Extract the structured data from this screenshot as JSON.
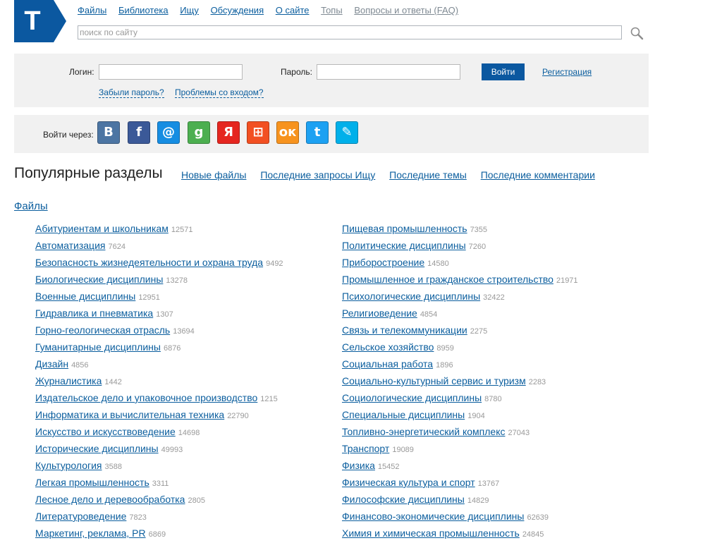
{
  "logo": {
    "letter": "T"
  },
  "topnav": [
    {
      "label": "Файлы"
    },
    {
      "label": "Библиотека"
    },
    {
      "label": "Ищу"
    },
    {
      "label": "Обсуждения"
    },
    {
      "label": "О сайте"
    },
    {
      "label": "Топы"
    },
    {
      "label": "Вопросы и ответы (FAQ)"
    }
  ],
  "search": {
    "placeholder": "поиск по сайту",
    "value": ""
  },
  "login": {
    "login_label": "Логин:",
    "password_label": "Пароль:",
    "submit_label": "Войти",
    "register_label": "Регистрация",
    "forgot_label": "Забыли пароль?",
    "problems_label": "Проблемы со входом?"
  },
  "social": {
    "label": "Войти через:",
    "providers": [
      {
        "name": "vkontakte-icon",
        "glyph": "В",
        "color": "#4c75a3"
      },
      {
        "name": "facebook-icon",
        "glyph": "f",
        "color": "#3b5998"
      },
      {
        "name": "mailru-icon",
        "glyph": "@",
        "color": "#168de2"
      },
      {
        "name": "google-icon",
        "glyph": "g",
        "color": "#4caf50"
      },
      {
        "name": "yandex-icon",
        "glyph": "Я",
        "color": "#e52620"
      },
      {
        "name": "windows-live-icon",
        "glyph": "⊞",
        "color": "#f25022"
      },
      {
        "name": "odnoklassniki-icon",
        "glyph": "ок",
        "color": "#f7931e"
      },
      {
        "name": "twitter-icon",
        "glyph": "t",
        "color": "#1da1f2"
      },
      {
        "name": "livejournal-icon",
        "glyph": "✎",
        "color": "#00b0ea"
      }
    ]
  },
  "section": {
    "title": "Популярные разделы",
    "tabs": [
      {
        "label": "Новые файлы"
      },
      {
        "label": "Последние запросы Ищу"
      },
      {
        "label": "Последние темы"
      },
      {
        "label": "Последние комментарии"
      }
    ],
    "files_heading": "Файлы"
  },
  "categories_left": [
    {
      "label": "Абитуриентам и школьникам",
      "count": "12571"
    },
    {
      "label": "Автоматизация",
      "count": "7624"
    },
    {
      "label": "Безопасность жизнедеятельности и охрана труда",
      "count": "9492"
    },
    {
      "label": "Биологические дисциплины",
      "count": "13278"
    },
    {
      "label": "Военные дисциплины",
      "count": "12951"
    },
    {
      "label": "Гидравлика и пневматика",
      "count": "1307"
    },
    {
      "label": "Горно-геологическая отрасль",
      "count": "13694"
    },
    {
      "label": "Гуманитарные дисциплины",
      "count": "6876"
    },
    {
      "label": "Дизайн",
      "count": "4856"
    },
    {
      "label": "Журналистика",
      "count": "1442"
    },
    {
      "label": "Издательское дело и упаковочное производство",
      "count": "1215"
    },
    {
      "label": "Информатика и вычислительная техника",
      "count": "22790"
    },
    {
      "label": "Искусство и искусствоведение",
      "count": "14698"
    },
    {
      "label": "Исторические дисциплины",
      "count": "49993"
    },
    {
      "label": "Культурология",
      "count": "3588"
    },
    {
      "label": "Легкая промышленность",
      "count": "3311"
    },
    {
      "label": "Лесное дело и деревообработка",
      "count": "2805"
    },
    {
      "label": "Литературоведение",
      "count": "7823"
    },
    {
      "label": "Маркетинг, реклама, PR",
      "count": "6869"
    }
  ],
  "categories_right": [
    {
      "label": "Пищевая промышленность",
      "count": "7355"
    },
    {
      "label": "Политические дисциплины",
      "count": "7260"
    },
    {
      "label": "Приборостроение",
      "count": "14580"
    },
    {
      "label": "Промышленное и гражданское строительство",
      "count": "21971"
    },
    {
      "label": "Психологические дисциплины",
      "count": "32422"
    },
    {
      "label": "Религиоведение",
      "count": "4854"
    },
    {
      "label": "Связь и телекоммуникации",
      "count": "2275"
    },
    {
      "label": "Сельское хозяйство",
      "count": "8959"
    },
    {
      "label": "Социальная работа",
      "count": "1896"
    },
    {
      "label": "Социально-культурный сервис и туризм",
      "count": "2283"
    },
    {
      "label": "Социологические дисциплины",
      "count": "8780"
    },
    {
      "label": "Специальные дисциплины",
      "count": "1904"
    },
    {
      "label": "Топливно-энергетический комплекс",
      "count": "27043"
    },
    {
      "label": "Транспорт",
      "count": "19089"
    },
    {
      "label": "Физика",
      "count": "15452"
    },
    {
      "label": "Физическая культура и спорт",
      "count": "13767"
    },
    {
      "label": "Философские дисциплины",
      "count": "14829"
    },
    {
      "label": "Финансово-экономические дисциплины",
      "count": "62639"
    },
    {
      "label": "Химия и химическая промышленность",
      "count": "24845"
    }
  ]
}
